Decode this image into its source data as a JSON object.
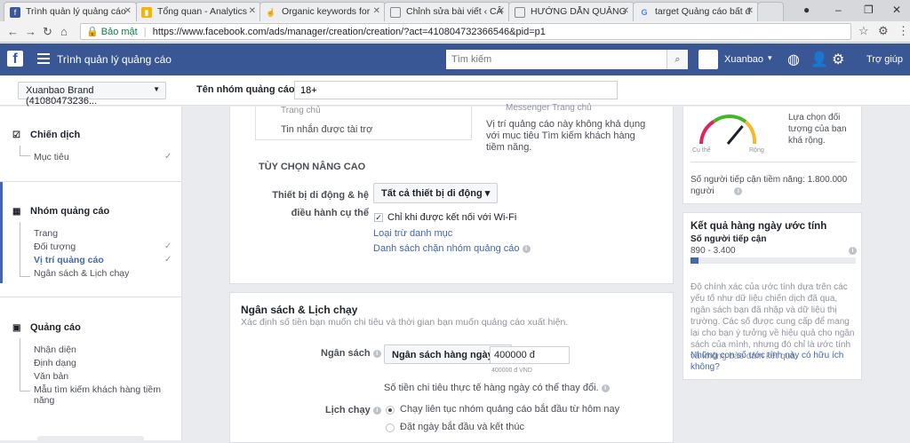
{
  "browser": {
    "tabs": [
      {
        "title": "Trình quản lý quảng cáo",
        "icon": "facebook-icon",
        "active": true
      },
      {
        "title": "Tổng quan - Analytics",
        "icon": "analytics-icon"
      },
      {
        "title": "Organic keywords for ",
        "icon": "semrush-icon"
      },
      {
        "title": "Chỉnh sửa bài viết ‹ CÂ",
        "icon": "document-icon"
      },
      {
        "title": "HƯỚNG DẪN QUẢNG",
        "icon": "document-icon"
      },
      {
        "title": "target Quảng cáo bất đ",
        "icon": "google-icon"
      }
    ],
    "security_label": "Bảo mật",
    "url": "https://www.facebook.com/ads/manager/creation/creation/?act=410804732366546&pid=p1"
  },
  "header": {
    "logo": "f",
    "app_title": "Trình quản lý quảng cáo",
    "search_placeholder": "Tìm kiếm",
    "account_name": "Xuanbao",
    "help_label": "Trợ giúp"
  },
  "form": {
    "account_selector": "Xuanbao Brand (41080473236...",
    "adset_name_label": "Tên nhóm quảng cáo",
    "adset_name_value": "18+"
  },
  "sidebar": {
    "campaign": {
      "title": "Chiến dịch",
      "items": [
        {
          "label": "Mục tiêu",
          "checked": true
        }
      ]
    },
    "adset": {
      "title": "Nhóm quảng cáo",
      "items": [
        {
          "label": "Trang",
          "checked": false
        },
        {
          "label": "Đối tượng",
          "checked": true
        },
        {
          "label": "Vị trí quảng cáo",
          "checked": true,
          "active": true
        },
        {
          "label": "Ngân sách & Lịch chạy",
          "checked": false
        }
      ]
    },
    "ad": {
      "title": "Quảng cáo",
      "items": [
        {
          "label": "Nhận diện"
        },
        {
          "label": "Định dạng"
        },
        {
          "label": "Văn bản"
        },
        {
          "label": "Mẫu tìm kiếm khách hàng tiềm năng"
        }
      ]
    }
  },
  "placements": {
    "partial_top": "Messenger Trang chủ",
    "home_item": "Trang chủ",
    "sponsored_item": "Tin nhắn được tài trợ",
    "note": "Vị trí quảng cáo này không khả dụng với mục tiêu Tìm kiếm khách hàng tiềm năng.",
    "advanced_title": "TÙY CHỌN NÂNG CAO",
    "device_label": "Thiết bị di động & hệ điều hành cụ thể",
    "device_button": "Tất cả thiết bị di động",
    "wifi_label": "Chỉ khi được kết nối với Wi-Fi",
    "exclude_link": "Loại trừ danh mục",
    "block_list_link": "Danh sách chặn nhóm quảng cáo"
  },
  "budget": {
    "title": "Ngân sách & Lịch chạy",
    "subtitle": "Xác định số tiền bạn muốn chi tiêu và thời gian bạn muốn quảng cáo xuất hiện.",
    "budget_label": "Ngân sách",
    "budget_type": "Ngân sách hàng ngày",
    "budget_value": "400000 đ",
    "budget_hint": "400000 đ VND",
    "actual_spend_note": "Số tiền chi tiêu thực tế hàng ngày có thể thay đổi.",
    "schedule_label": "Lịch chạy",
    "schedule_options": [
      {
        "label": "Chạy liên tục nhóm quảng cáo bắt đầu từ hôm nay",
        "selected": true
      },
      {
        "label": "Đặt ngày bắt đầu và kết thúc",
        "selected": false
      }
    ]
  },
  "audience_panel": {
    "gauge_low": "Cụ thể",
    "gauge_high": "Rộng",
    "description": "Lựa chọn đối tượng của bạn khá rộng.",
    "reach_text": "Số người tiếp cận tiềm năng: 1.800.000 người",
    "gauge_level": 0.72
  },
  "estimate_panel": {
    "title": "Kết quả hàng ngày ước tính",
    "reach_label": "Số người tiếp cận",
    "reach_range": "890 - 3.400",
    "reach_fill": 0.05,
    "disclaimer": "Độ chính xác của ước tính dựa trên các yếu tố như dữ liệu chiến dịch đã qua, ngân sách bạn đã nhập và dữ liệu thị trường. Các số được cung cấp để mang lại cho bạn ý tưởng về hiệu quả cho ngân sách của mình, nhưng đó chỉ là ước tính và không bảo đảm kết quả.",
    "helpful_link": "Những con số ước tính này có hữu ích không?"
  },
  "colors": {
    "facebook_blue": "#3a5795",
    "link": "#4267b2",
    "gauge_green": "#42b72a",
    "gauge_red": "#e0245e"
  }
}
